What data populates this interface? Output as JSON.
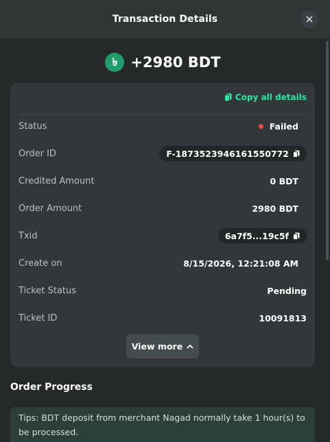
{
  "header": {
    "title": "Transaction Details"
  },
  "amount": {
    "currency_symbol": "৳",
    "text": "+2980 BDT"
  },
  "card": {
    "copy_all_label": "Copy all details",
    "rows": [
      {
        "label": "Status",
        "value": "Failed"
      },
      {
        "label": "Order ID",
        "value": "F-187352394616155077​2"
      },
      {
        "label": "Credited Amount",
        "value": "0 BDT"
      },
      {
        "label": "Order Amount",
        "value": "2980 BDT"
      },
      {
        "label": "Txid",
        "value": "6a7f5...19c5f"
      },
      {
        "label": "Create on",
        "value": "8/15/2026, 12:21:08 AM"
      },
      {
        "label": "Ticket Status",
        "value": "Pending"
      },
      {
        "label": "Ticket ID",
        "value": "10091813"
      }
    ],
    "view_more_label": "View more"
  },
  "order_progress": {
    "title": "Order Progress",
    "tips": "Tips: BDT deposit from merchant Nagad normally take 1 hour(s) to be processed."
  },
  "colors": {
    "accent_green": "#2ee59d",
    "failed_red": "#ea4d4d",
    "currency_icon_bg": "#1f9d6a"
  }
}
